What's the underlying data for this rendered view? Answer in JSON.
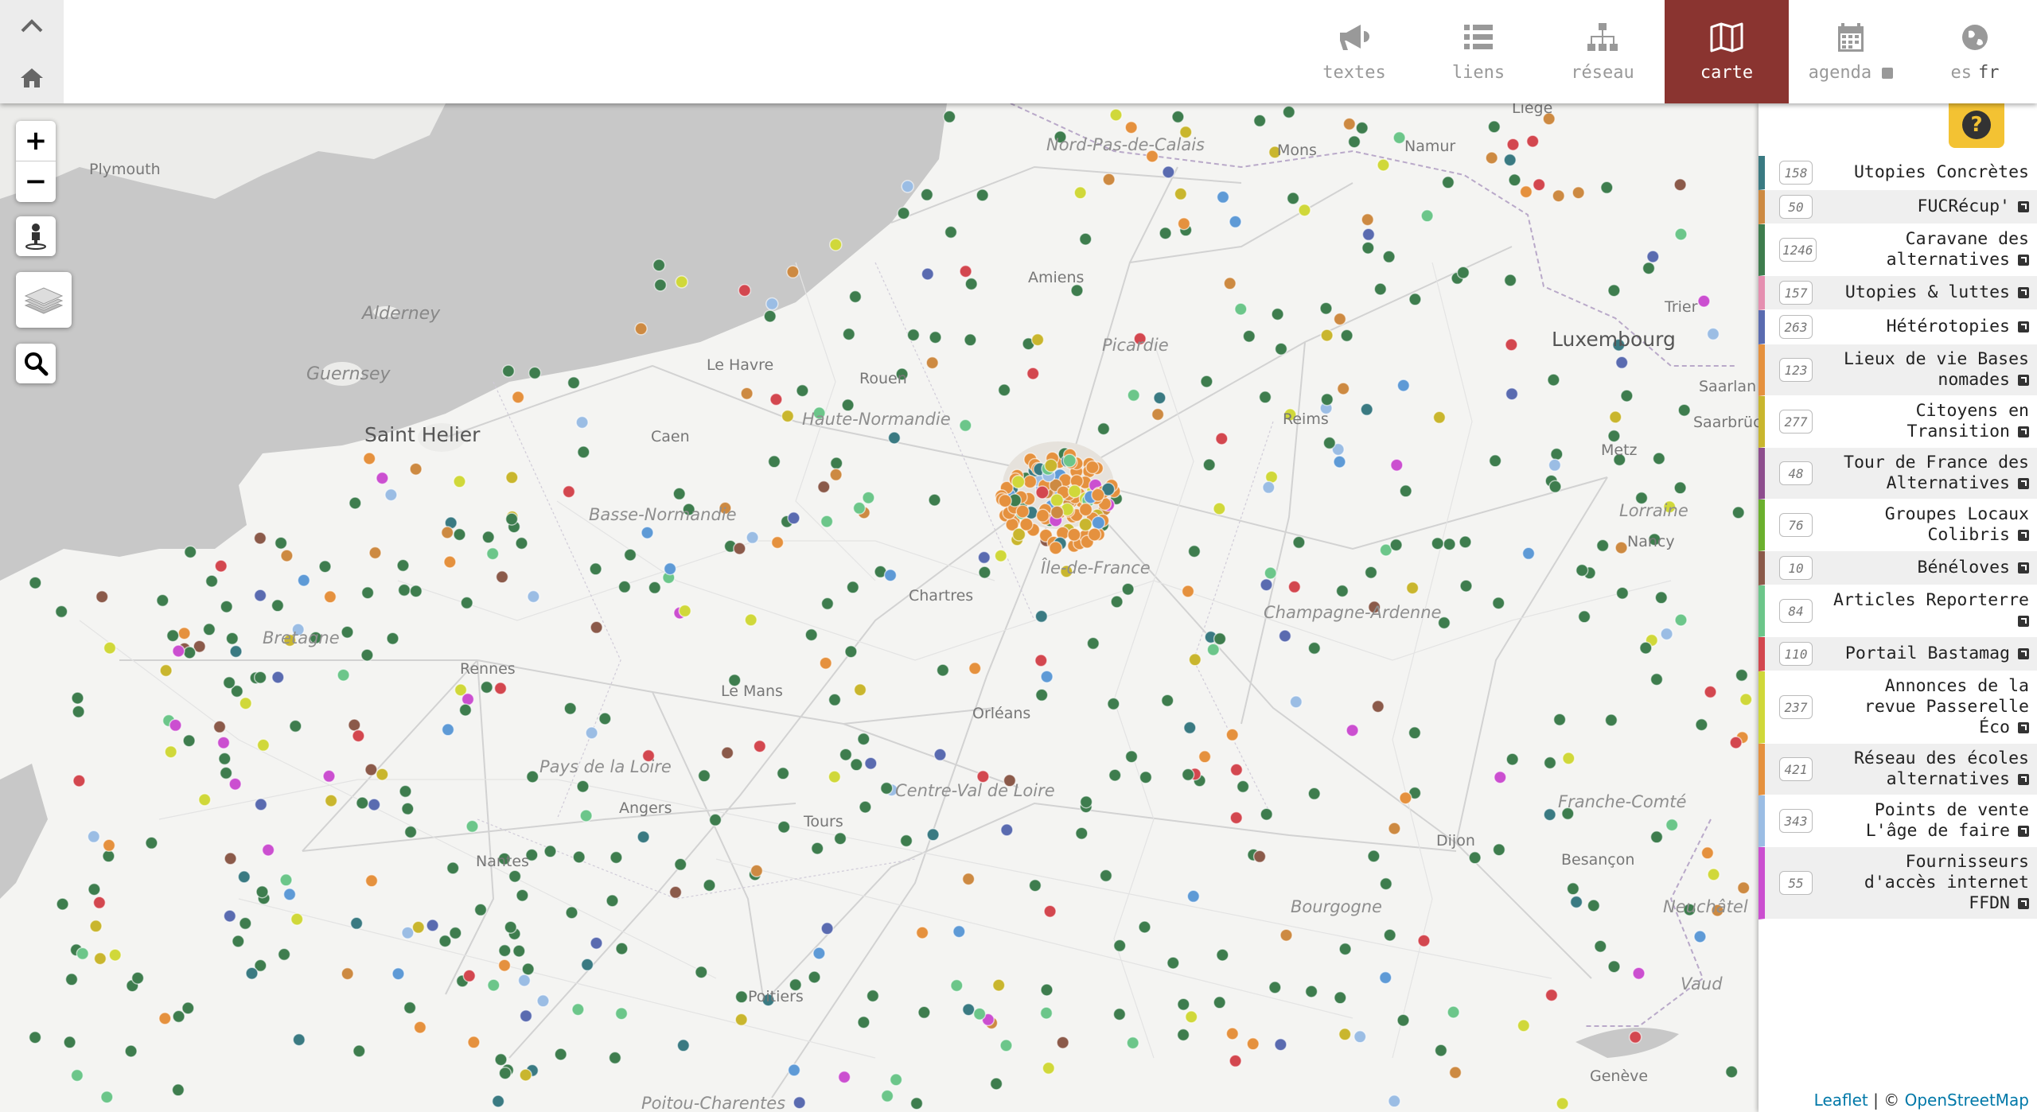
{
  "nav": {
    "items": [
      {
        "key": "textes",
        "label": "textes",
        "icon": "bullhorn-icon"
      },
      {
        "key": "liens",
        "label": "liens",
        "icon": "list-icon"
      },
      {
        "key": "reseau",
        "label": "réseau",
        "icon": "sitemap-icon"
      },
      {
        "key": "carte",
        "label": "carte",
        "icon": "map-icon",
        "active": true
      },
      {
        "key": "agenda",
        "label": "agenda",
        "icon": "calendar-icon"
      }
    ],
    "lang": {
      "es": "es",
      "fr": "fr"
    }
  },
  "map": {
    "zoom_in": "+",
    "zoom_out": "−",
    "places": {
      "plymouth": "Plymouth",
      "alderney": "Alderney",
      "guernsey": "Guernsey",
      "saint_helier": "Saint Helier",
      "le_havre": "Le Havre",
      "rouen": "Rouen",
      "caen": "Caen",
      "nord": "Nord-Pas-de-Calais",
      "mons": "Mons",
      "namur": "Namur",
      "liege": "Liège",
      "amiens": "Amiens",
      "picardie": "Picardie",
      "luxembourg": "Luxembourg",
      "trier": "Trier",
      "reims": "Reims",
      "saarlan": "Saarlan",
      "saarbruck": "Saarbrück",
      "haute_normandie": "Haute-Normandie",
      "basse_normandie": "Basse-Normandie",
      "ile_de_france": "Île-de-France",
      "chartres": "Chartres",
      "champagne": "Champagne-Ardenne",
      "lorraine": "Lorraine",
      "nancy": "Nancy",
      "bretagne": "Bretagne",
      "rennes": "Rennes",
      "le_mans": "Le Mans",
      "orleans": "Orléans",
      "pays_loire": "Pays de la Loire",
      "angers": "Angers",
      "tours": "Tours",
      "centre": "Centre-Val de Loire",
      "nantes": "Nantes",
      "bourgogne": "Bourgogne",
      "franche_comte": "Franche-Comté",
      "besancon": "Besançon",
      "dijon": "Dijon",
      "neuchatel": "Neuchâtel",
      "vaud": "Vaud",
      "poitiers": "Poitiers",
      "poitou": "Poitou-Charentes",
      "geneve": "Genève",
      "metz": "Metz"
    },
    "marker_colors": [
      "#3e7d4e",
      "#5e9ad6",
      "#9bbde4",
      "#d0d83a",
      "#e5913e",
      "#d3474f",
      "#cb4fd0",
      "#8b5a4a",
      "#5a6bb0",
      "#3a7a82",
      "#6cc68a",
      "#c9b62e",
      "#cd8a42"
    ]
  },
  "sidebar": {
    "help": "?",
    "categories": [
      {
        "count": "158",
        "name": "Utopies Concrètes",
        "color": "#3a7a82",
        "link": false
      },
      {
        "count": "50",
        "name": "FUCRécup'",
        "color": "#cd8a42",
        "link": true
      },
      {
        "count": "1246",
        "name": "Caravane des alternatives",
        "color": "#3e7d4e",
        "link": true
      },
      {
        "count": "157",
        "name": "Utopies & luttes",
        "color": "#e58fb0",
        "link": true
      },
      {
        "count": "263",
        "name": "Hétérotopies",
        "color": "#5a6bb0",
        "link": true
      },
      {
        "count": "123",
        "name": "Lieux de vie Bases nomades",
        "color": "#e5913e",
        "link": true
      },
      {
        "count": "277",
        "name": "Citoyens en Transition",
        "color": "#c9b62e",
        "link": true
      },
      {
        "count": "48",
        "name": "Tour de France des Alternatives",
        "color": "#8e4e8e",
        "link": true
      },
      {
        "count": "76",
        "name": "Groupes Locaux Colibris",
        "color": "#6bb02e",
        "link": true
      },
      {
        "count": "10",
        "name": "Bénéloves",
        "color": "#8b5a4a",
        "link": true
      },
      {
        "count": "84",
        "name": "Articles Reporterre",
        "color": "#6cc68a",
        "link": true
      },
      {
        "count": "110",
        "name": "Portail Bastamag",
        "color": "#d3474f",
        "link": true
      },
      {
        "count": "237",
        "name": "Annonces de la revue Passerelle Éco",
        "color": "#d0d83a",
        "link": true
      },
      {
        "count": "421",
        "name": "Réseau des écoles alternatives",
        "color": "#e5913e",
        "link": true
      },
      {
        "count": "343",
        "name": "Points de vente L'âge de faire",
        "color": "#9bbde4",
        "link": true
      },
      {
        "count": "55",
        "name": "Fournisseurs d'accès internet FFDN",
        "color": "#cb4fd0",
        "link": true
      }
    ]
  },
  "attribution": {
    "leaflet": "Leaflet",
    "sep": " | © ",
    "osm": "OpenStreetMap"
  }
}
